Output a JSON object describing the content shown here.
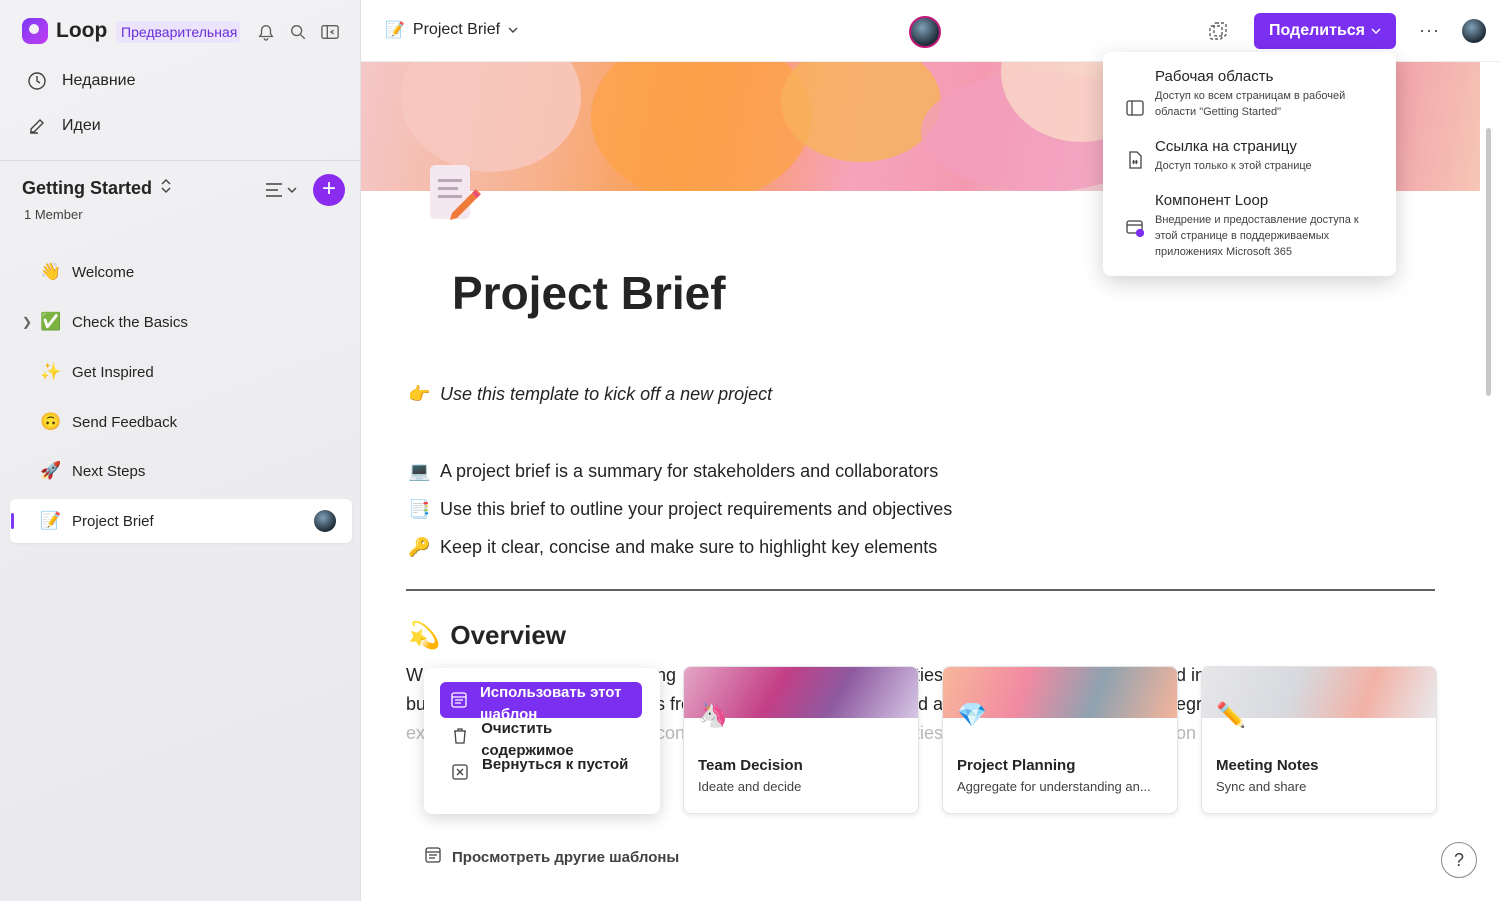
{
  "app": {
    "name": "Loop",
    "badge": "Предварительная"
  },
  "nav": {
    "recent": "Недавние",
    "ideas": "Идеи"
  },
  "workspace": {
    "name": "Getting Started",
    "members": "1 Member"
  },
  "pages": [
    {
      "emoji": "👋",
      "label": "Welcome"
    },
    {
      "emoji": "✅",
      "label": "Check the Basics"
    },
    {
      "emoji": "✨",
      "label": "Get Inspired"
    },
    {
      "emoji": "🙃",
      "label": "Send Feedback"
    },
    {
      "emoji": "🚀",
      "label": "Next Steps"
    },
    {
      "emoji": "📝",
      "label": "Project Brief"
    }
  ],
  "topbar": {
    "breadcrumb": "Project Brief",
    "share_label": "Поделиться",
    "more": "···"
  },
  "document": {
    "title": "Project Brief",
    "intro_emoji": "👉",
    "intro": "Use this template to kick off a new project",
    "bullets": [
      {
        "emoji": "💻",
        "text": "A project brief is a summary for stakeholders and collaborators"
      },
      {
        "emoji": "📑",
        "text": "Use this brief to outline your project requirements and objectives"
      },
      {
        "emoji": "🔑",
        "text": "Keep it clear, concise and make sure to highlight key elements"
      }
    ],
    "overview_emoji": "💫",
    "overview": "Overview",
    "ghost": {
      "l1a": "W",
      "l1b": "ng",
      "l1c": "ties",
      "l1d": "d in",
      "l2a": "bu",
      "l2b": "s fro",
      "l2c": "d a",
      "l2d": "egr",
      "l3a": "ex",
      "l3b": "con",
      "l3c": "ties",
      "l3d": "on"
    }
  },
  "context_menu": {
    "use_template": "Использовать этот шаблон",
    "clear": "Очистить содержимое",
    "back_to_blank": "Вернуться к пустой"
  },
  "templates": [
    {
      "emoji": "🦄",
      "title": "Team Decision",
      "subtitle": "Ideate and decide"
    },
    {
      "emoji": "💎",
      "title": "Project Planning",
      "subtitle": "Aggregate for understanding an..."
    },
    {
      "emoji": "✏️",
      "title": "Meeting Notes",
      "subtitle": "Sync and share"
    }
  ],
  "more_templates": "Просмотреть другие шаблоны",
  "share_menu": [
    {
      "title": "Рабочая область",
      "desc": "Доступ ко всем страницам в рабочей области \"Getting Started\""
    },
    {
      "title": "Ссылка на страницу",
      "desc": "Доступ только к этой странице"
    },
    {
      "title": "Компонент Loop",
      "desc": "Внедрение и предоставление доступа к этой странице в поддерживаемых приложениях Microsoft 365"
    }
  ],
  "help": "?",
  "colors": {
    "accent": "#7b2ff0",
    "accent_light": "#ece4fd"
  }
}
